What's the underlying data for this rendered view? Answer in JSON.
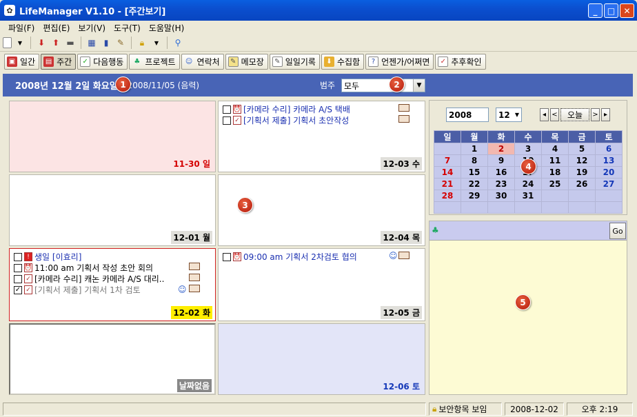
{
  "window": {
    "title": "LifeManager V1.10 - [주간보기]"
  },
  "menu": [
    "파일(F)",
    "편집(E)",
    "보기(V)",
    "도구(T)",
    "도움말(H)"
  ],
  "toolbar_views": [
    "일간",
    "주간",
    "다음행동",
    "프로젝트",
    "연락처",
    "메모장",
    "일일기록",
    "수집함",
    "언젠가/어쩌면",
    "추후확인"
  ],
  "header": {
    "date": "2008년 12월 2일 화요일",
    "lunar": "2008/11/05 (음력)",
    "category_label": "범주",
    "category_value": "모두"
  },
  "days": {
    "sun": {
      "label": "11-30 일"
    },
    "mon": {
      "label": "12-01 월"
    },
    "tue": {
      "label": "12-02 화",
      "items": [
        "생일 [이효리]",
        "11:00 am 기획서 작성 초안 회의",
        "[카메라 수리] 캐논 카메라 A/S 대리..",
        "[기획서 제출] 기획서 1차 검토"
      ]
    },
    "wed": {
      "label": "12-03 수",
      "items": [
        "[카메라 수리] 카메라 A/S 택배",
        "[기획서 제출] 기획서 초안작성"
      ]
    },
    "thu": {
      "label": "12-04 목"
    },
    "fri": {
      "label": "12-05 금",
      "items": [
        "09:00 am 기획서 2차검토 협의"
      ]
    },
    "sat": {
      "label": "12-06 토"
    },
    "nodate": {
      "label": "날짜없음"
    }
  },
  "minical": {
    "year": "2008",
    "month": "12",
    "today_label": "오늘",
    "weekdays": [
      "일",
      "월",
      "화",
      "수",
      "목",
      "금",
      "토"
    ],
    "weeks": [
      [
        "",
        "1",
        "2",
        "3",
        "4",
        "5",
        "6"
      ],
      [
        "7",
        "8",
        "9",
        "10",
        "11",
        "12",
        "13"
      ],
      [
        "14",
        "15",
        "16",
        "17",
        "18",
        "19",
        "20"
      ],
      [
        "21",
        "22",
        "23",
        "24",
        "25",
        "26",
        "27"
      ],
      [
        "28",
        "29",
        "30",
        "31",
        "",
        "",
        ""
      ],
      [
        "",
        "",
        "",
        "",
        "",
        "",
        ""
      ]
    ],
    "today": "2"
  },
  "go_label": "Go",
  "badges": [
    "1",
    "2",
    "3",
    "4",
    "5"
  ],
  "status": {
    "secure": "보안항목 보임",
    "date": "2008-12-02",
    "time": "오후 2:19"
  }
}
